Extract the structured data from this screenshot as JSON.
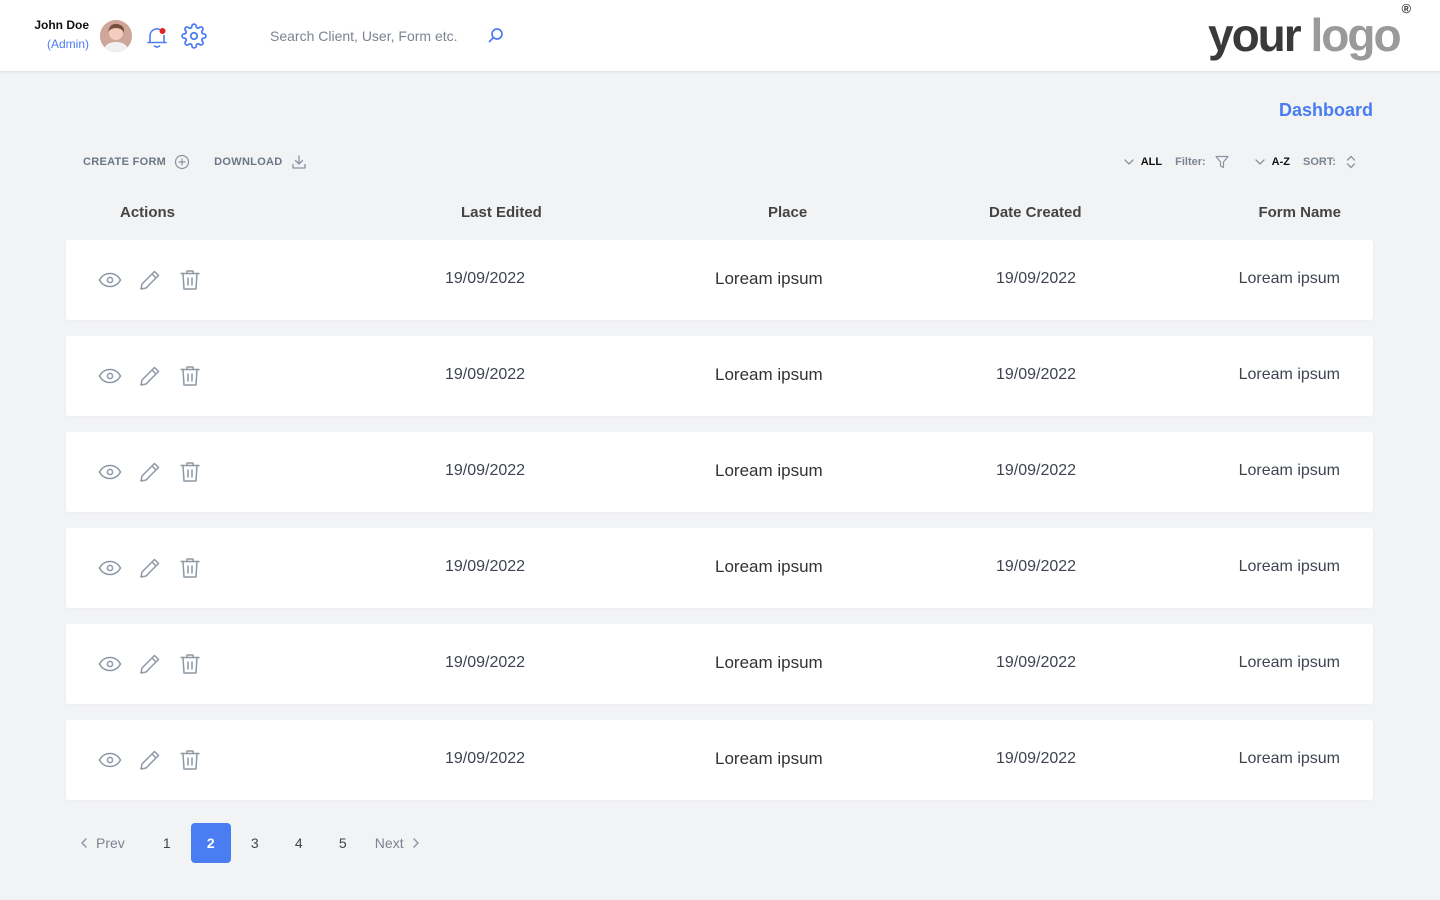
{
  "header": {
    "user_name": "John Doe",
    "user_role": "(Admin)",
    "search_placeholder": "Search Client, User, Form etc.",
    "logo_text_a": "your ",
    "logo_text_b": "logo",
    "logo_mark": "®",
    "notification_dot_color": "#E02424",
    "accent_color": "#4A7CF2"
  },
  "page_title": "Dashboard",
  "toolbar": {
    "create_label": "CREATE FORM",
    "download_label": "DOWNLOAD",
    "filter_value": "ALL",
    "filter_label": "Filter:",
    "sort_value": "A-Z",
    "sort_label": "SORT:"
  },
  "table": {
    "columns": [
      "Actions",
      "Last Edited",
      "Place",
      "Date Created",
      "Form Name"
    ],
    "action_icons": [
      "eye-icon",
      "pencil-icon",
      "trash-icon"
    ],
    "rows": [
      {
        "last_edited": "19/09/2022",
        "place": "Loream ipsum",
        "date_created": "19/09/2022",
        "form_name": "Loream ipsum"
      },
      {
        "last_edited": "19/09/2022",
        "place": "Loream ipsum",
        "date_created": "19/09/2022",
        "form_name": "Loream ipsum"
      },
      {
        "last_edited": "19/09/2022",
        "place": "Loream ipsum",
        "date_created": "19/09/2022",
        "form_name": "Loream ipsum"
      },
      {
        "last_edited": "19/09/2022",
        "place": "Loream ipsum",
        "date_created": "19/09/2022",
        "form_name": "Loream ipsum"
      },
      {
        "last_edited": "19/09/2022",
        "place": "Loream ipsum",
        "date_created": "19/09/2022",
        "form_name": "Loream ipsum"
      },
      {
        "last_edited": "19/09/2022",
        "place": "Loream ipsum",
        "date_created": "19/09/2022",
        "form_name": "Loream ipsum"
      }
    ]
  },
  "pagination": {
    "prev_label": "Prev",
    "next_label": "Next",
    "pages": [
      "1",
      "2",
      "3",
      "4",
      "5"
    ],
    "current_page": "2"
  }
}
